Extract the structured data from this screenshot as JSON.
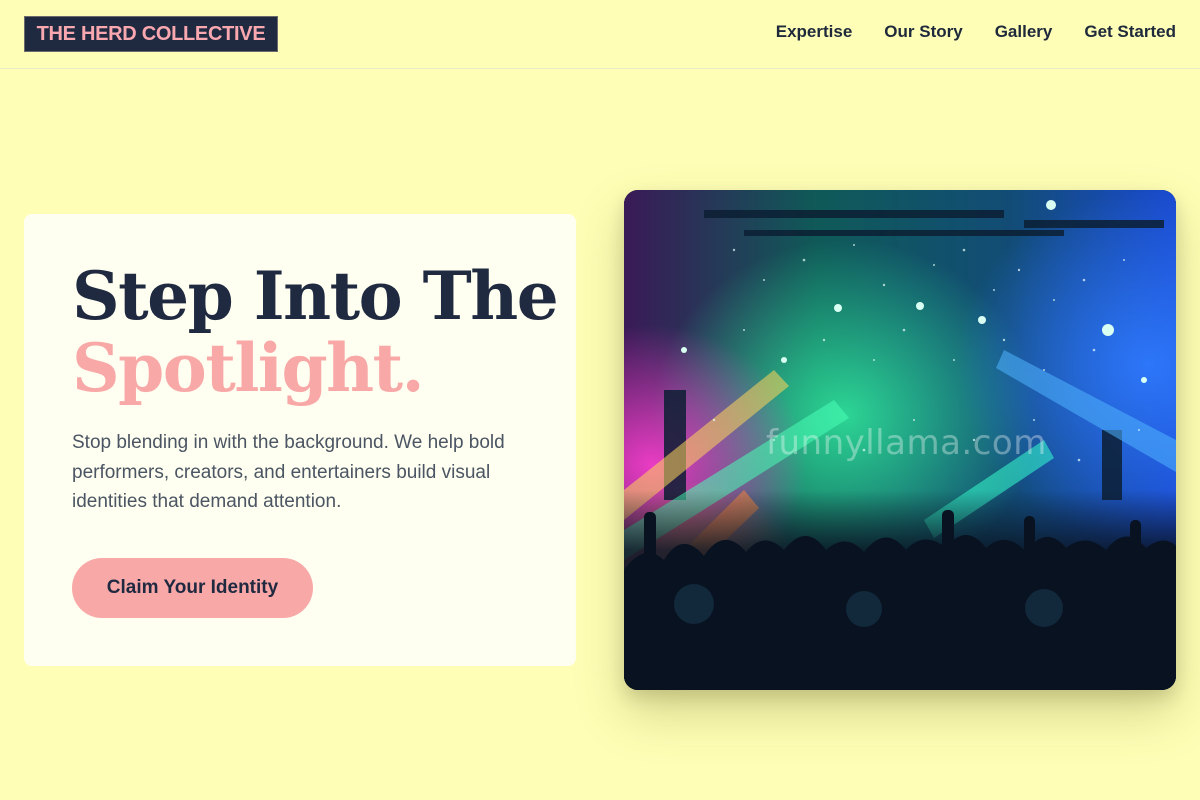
{
  "header": {
    "logo_text": "THE HERD COLLECTIVE",
    "nav": [
      {
        "label": "Expertise"
      },
      {
        "label": "Our Story"
      },
      {
        "label": "Gallery"
      },
      {
        "label": "Get Started"
      }
    ]
  },
  "hero": {
    "headline_line1": "Step Into The",
    "headline_line2": "Spotlight.",
    "subcopy": "Stop blending in with the background. We help bold performers, creators, and entertainers build visual identities that demand attention.",
    "cta_label": "Claim Your Identity"
  },
  "image": {
    "watermark": "funnyllama.com"
  },
  "colors": {
    "background": "#fefeb6",
    "card": "#fefff0",
    "navy": "#1f2940",
    "accent_pink": "#f9a8a8",
    "body_text": "#4b5563"
  }
}
